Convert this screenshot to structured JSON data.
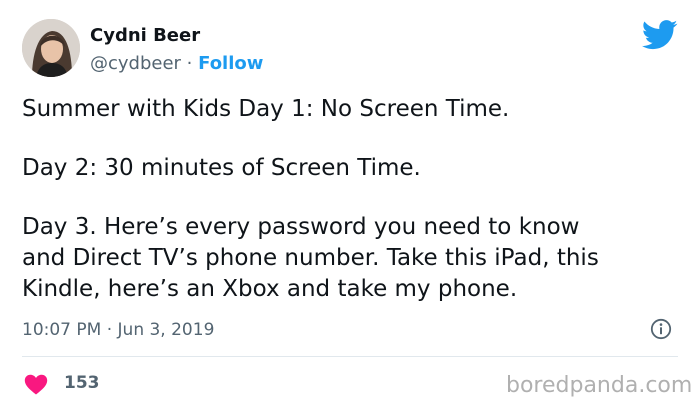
{
  "author": {
    "display_name": "Cydni Beer",
    "handle": "@cydbeer",
    "separator": " · ",
    "follow_label": "Follow",
    "avatar_icon": "profile-photo"
  },
  "tweet": {
    "paragraphs": [
      [
        "Summer with Kids Day 1: No Screen Time."
      ],
      [
        "Day 2: 30 minutes of Screen Time."
      ],
      [
        "Day 3. Here’s every password you need to know",
        "and Direct TV’s phone number. Take this iPad, this",
        "Kindle, here’s an Xbox and take my phone."
      ]
    ],
    "timestamp": "10:07 PM · Jun 3, 2019",
    "likes": "153"
  },
  "icons": {
    "brand": "twitter-bird-icon",
    "info": "info-icon",
    "like": "heart-icon"
  },
  "colors": {
    "accent": "#1d9bf0",
    "like": "#f91880",
    "text": "#0f1419",
    "secondary": "#536471"
  },
  "watermark": "boredpanda.com"
}
